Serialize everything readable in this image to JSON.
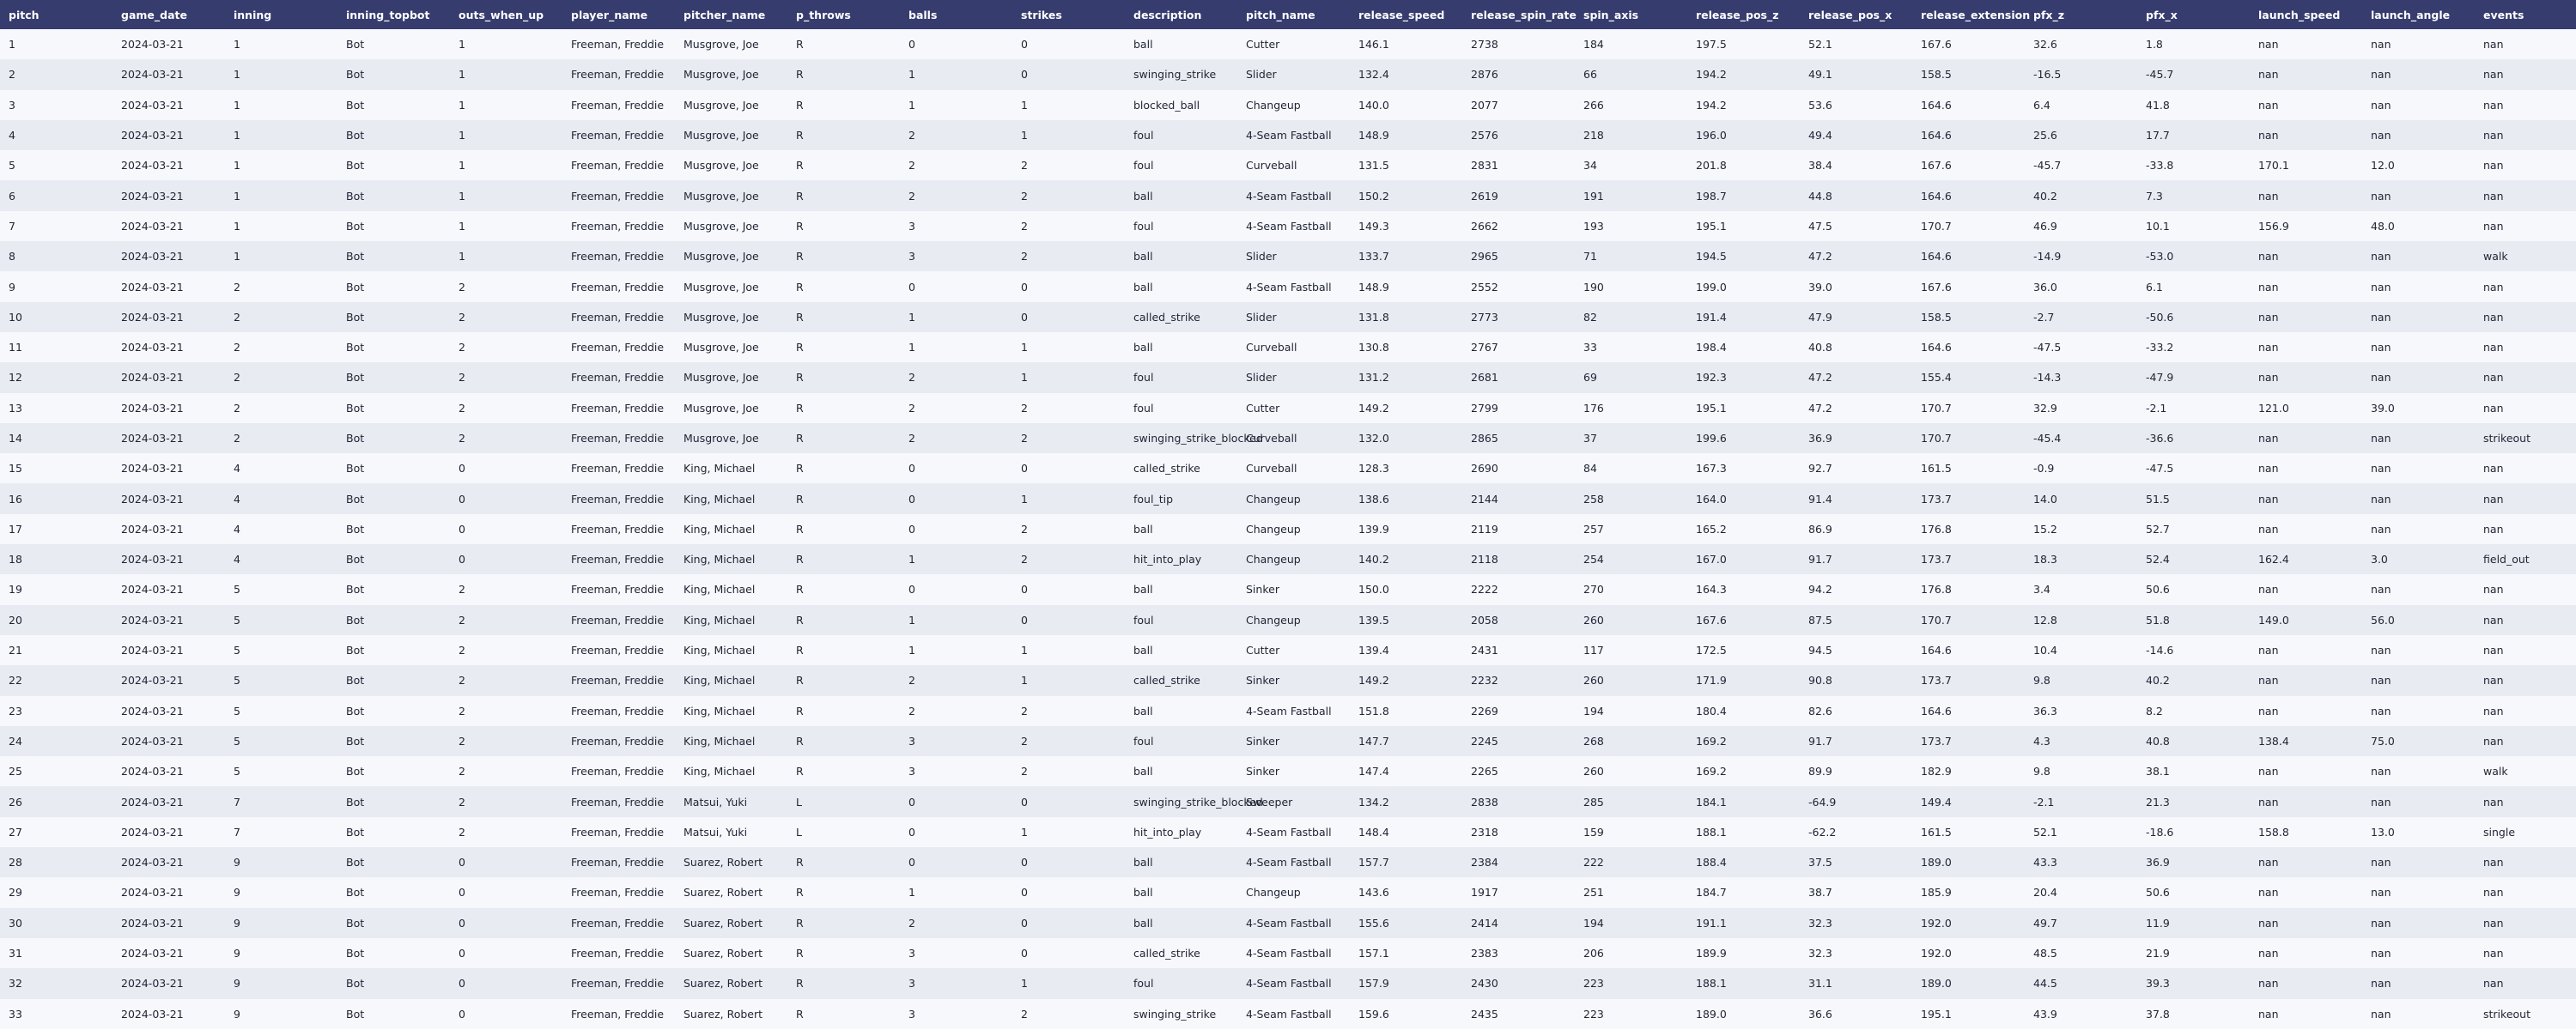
{
  "table": {
    "columns": [
      "pitch",
      "game_date",
      "inning",
      "inning_topbot",
      "outs_when_up",
      "player_name",
      "pitcher_name",
      "p_throws",
      "balls",
      "strikes",
      "description",
      "pitch_name",
      "release_speed",
      "release_spin_rate",
      "spin_axis",
      "release_pos_z",
      "release_pos_x",
      "release_extension",
      "pfx_z",
      "pfx_x",
      "launch_speed",
      "launch_angle",
      "events"
    ],
    "rows": [
      [
        "1",
        "2024-03-21",
        "1",
        "Bot",
        "1",
        "Freeman, Freddie",
        "Musgrove, Joe",
        "R",
        "0",
        "0",
        "ball",
        "Cutter",
        "146.1",
        "2738",
        "184",
        "197.5",
        "52.1",
        "167.6",
        "32.6",
        "1.8",
        "nan",
        "nan",
        "nan"
      ],
      [
        "2",
        "2024-03-21",
        "1",
        "Bot",
        "1",
        "Freeman, Freddie",
        "Musgrove, Joe",
        "R",
        "1",
        "0",
        "swinging_strike",
        "Slider",
        "132.4",
        "2876",
        "66",
        "194.2",
        "49.1",
        "158.5",
        "-16.5",
        "-45.7",
        "nan",
        "nan",
        "nan"
      ],
      [
        "3",
        "2024-03-21",
        "1",
        "Bot",
        "1",
        "Freeman, Freddie",
        "Musgrove, Joe",
        "R",
        "1",
        "1",
        "blocked_ball",
        "Changeup",
        "140.0",
        "2077",
        "266",
        "194.2",
        "53.6",
        "164.6",
        "6.4",
        "41.8",
        "nan",
        "nan",
        "nan"
      ],
      [
        "4",
        "2024-03-21",
        "1",
        "Bot",
        "1",
        "Freeman, Freddie",
        "Musgrove, Joe",
        "R",
        "2",
        "1",
        "foul",
        "4-Seam Fastball",
        "148.9",
        "2576",
        "218",
        "196.0",
        "49.4",
        "164.6",
        "25.6",
        "17.7",
        "nan",
        "nan",
        "nan"
      ],
      [
        "5",
        "2024-03-21",
        "1",
        "Bot",
        "1",
        "Freeman, Freddie",
        "Musgrove, Joe",
        "R",
        "2",
        "2",
        "foul",
        "Curveball",
        "131.5",
        "2831",
        "34",
        "201.8",
        "38.4",
        "167.6",
        "-45.7",
        "-33.8",
        "170.1",
        "12.0",
        "nan"
      ],
      [
        "6",
        "2024-03-21",
        "1",
        "Bot",
        "1",
        "Freeman, Freddie",
        "Musgrove, Joe",
        "R",
        "2",
        "2",
        "ball",
        "4-Seam Fastball",
        "150.2",
        "2619",
        "191",
        "198.7",
        "44.8",
        "164.6",
        "40.2",
        "7.3",
        "nan",
        "nan",
        "nan"
      ],
      [
        "7",
        "2024-03-21",
        "1",
        "Bot",
        "1",
        "Freeman, Freddie",
        "Musgrove, Joe",
        "R",
        "3",
        "2",
        "foul",
        "4-Seam Fastball",
        "149.3",
        "2662",
        "193",
        "195.1",
        "47.5",
        "170.7",
        "46.9",
        "10.1",
        "156.9",
        "48.0",
        "nan"
      ],
      [
        "8",
        "2024-03-21",
        "1",
        "Bot",
        "1",
        "Freeman, Freddie",
        "Musgrove, Joe",
        "R",
        "3",
        "2",
        "ball",
        "Slider",
        "133.7",
        "2965",
        "71",
        "194.5",
        "47.2",
        "164.6",
        "-14.9",
        "-53.0",
        "nan",
        "nan",
        "walk"
      ],
      [
        "9",
        "2024-03-21",
        "2",
        "Bot",
        "2",
        "Freeman, Freddie",
        "Musgrove, Joe",
        "R",
        "0",
        "0",
        "ball",
        "4-Seam Fastball",
        "148.9",
        "2552",
        "190",
        "199.0",
        "39.0",
        "167.6",
        "36.0",
        "6.1",
        "nan",
        "nan",
        "nan"
      ],
      [
        "10",
        "2024-03-21",
        "2",
        "Bot",
        "2",
        "Freeman, Freddie",
        "Musgrove, Joe",
        "R",
        "1",
        "0",
        "called_strike",
        "Slider",
        "131.8",
        "2773",
        "82",
        "191.4",
        "47.9",
        "158.5",
        "-2.7",
        "-50.6",
        "nan",
        "nan",
        "nan"
      ],
      [
        "11",
        "2024-03-21",
        "2",
        "Bot",
        "2",
        "Freeman, Freddie",
        "Musgrove, Joe",
        "R",
        "1",
        "1",
        "ball",
        "Curveball",
        "130.8",
        "2767",
        "33",
        "198.4",
        "40.8",
        "164.6",
        "-47.5",
        "-33.2",
        "nan",
        "nan",
        "nan"
      ],
      [
        "12",
        "2024-03-21",
        "2",
        "Bot",
        "2",
        "Freeman, Freddie",
        "Musgrove, Joe",
        "R",
        "2",
        "1",
        "foul",
        "Slider",
        "131.2",
        "2681",
        "69",
        "192.3",
        "47.2",
        "155.4",
        "-14.3",
        "-47.9",
        "nan",
        "nan",
        "nan"
      ],
      [
        "13",
        "2024-03-21",
        "2",
        "Bot",
        "2",
        "Freeman, Freddie",
        "Musgrove, Joe",
        "R",
        "2",
        "2",
        "foul",
        "Cutter",
        "149.2",
        "2799",
        "176",
        "195.1",
        "47.2",
        "170.7",
        "32.9",
        "-2.1",
        "121.0",
        "39.0",
        "nan"
      ],
      [
        "14",
        "2024-03-21",
        "2",
        "Bot",
        "2",
        "Freeman, Freddie",
        "Musgrove, Joe",
        "R",
        "2",
        "2",
        "swinging_strike_blocked",
        "Curveball",
        "132.0",
        "2865",
        "37",
        "199.6",
        "36.9",
        "170.7",
        "-45.4",
        "-36.6",
        "nan",
        "nan",
        "strikeout"
      ],
      [
        "15",
        "2024-03-21",
        "4",
        "Bot",
        "0",
        "Freeman, Freddie",
        "King, Michael",
        "R",
        "0",
        "0",
        "called_strike",
        "Curveball",
        "128.3",
        "2690",
        "84",
        "167.3",
        "92.7",
        "161.5",
        "-0.9",
        "-47.5",
        "nan",
        "nan",
        "nan"
      ],
      [
        "16",
        "2024-03-21",
        "4",
        "Bot",
        "0",
        "Freeman, Freddie",
        "King, Michael",
        "R",
        "0",
        "1",
        "foul_tip",
        "Changeup",
        "138.6",
        "2144",
        "258",
        "164.0",
        "91.4",
        "173.7",
        "14.0",
        "51.5",
        "nan",
        "nan",
        "nan"
      ],
      [
        "17",
        "2024-03-21",
        "4",
        "Bot",
        "0",
        "Freeman, Freddie",
        "King, Michael",
        "R",
        "0",
        "2",
        "ball",
        "Changeup",
        "139.9",
        "2119",
        "257",
        "165.2",
        "86.9",
        "176.8",
        "15.2",
        "52.7",
        "nan",
        "nan",
        "nan"
      ],
      [
        "18",
        "2024-03-21",
        "4",
        "Bot",
        "0",
        "Freeman, Freddie",
        "King, Michael",
        "R",
        "1",
        "2",
        "hit_into_play",
        "Changeup",
        "140.2",
        "2118",
        "254",
        "167.0",
        "91.7",
        "173.7",
        "18.3",
        "52.4",
        "162.4",
        "3.0",
        "field_out"
      ],
      [
        "19",
        "2024-03-21",
        "5",
        "Bot",
        "2",
        "Freeman, Freddie",
        "King, Michael",
        "R",
        "0",
        "0",
        "ball",
        "Sinker",
        "150.0",
        "2222",
        "270",
        "164.3",
        "94.2",
        "176.8",
        "3.4",
        "50.6",
        "nan",
        "nan",
        "nan"
      ],
      [
        "20",
        "2024-03-21",
        "5",
        "Bot",
        "2",
        "Freeman, Freddie",
        "King, Michael",
        "R",
        "1",
        "0",
        "foul",
        "Changeup",
        "139.5",
        "2058",
        "260",
        "167.6",
        "87.5",
        "170.7",
        "12.8",
        "51.8",
        "149.0",
        "56.0",
        "nan"
      ],
      [
        "21",
        "2024-03-21",
        "5",
        "Bot",
        "2",
        "Freeman, Freddie",
        "King, Michael",
        "R",
        "1",
        "1",
        "ball",
        "Cutter",
        "139.4",
        "2431",
        "117",
        "172.5",
        "94.5",
        "164.6",
        "10.4",
        "-14.6",
        "nan",
        "nan",
        "nan"
      ],
      [
        "22",
        "2024-03-21",
        "5",
        "Bot",
        "2",
        "Freeman, Freddie",
        "King, Michael",
        "R",
        "2",
        "1",
        "called_strike",
        "Sinker",
        "149.2",
        "2232",
        "260",
        "171.9",
        "90.8",
        "173.7",
        "9.8",
        "40.2",
        "nan",
        "nan",
        "nan"
      ],
      [
        "23",
        "2024-03-21",
        "5",
        "Bot",
        "2",
        "Freeman, Freddie",
        "King, Michael",
        "R",
        "2",
        "2",
        "ball",
        "4-Seam Fastball",
        "151.8",
        "2269",
        "194",
        "180.4",
        "82.6",
        "164.6",
        "36.3",
        "8.2",
        "nan",
        "nan",
        "nan"
      ],
      [
        "24",
        "2024-03-21",
        "5",
        "Bot",
        "2",
        "Freeman, Freddie",
        "King, Michael",
        "R",
        "3",
        "2",
        "foul",
        "Sinker",
        "147.7",
        "2245",
        "268",
        "169.2",
        "91.7",
        "173.7",
        "4.3",
        "40.8",
        "138.4",
        "75.0",
        "nan"
      ],
      [
        "25",
        "2024-03-21",
        "5",
        "Bot",
        "2",
        "Freeman, Freddie",
        "King, Michael",
        "R",
        "3",
        "2",
        "ball",
        "Sinker",
        "147.4",
        "2265",
        "260",
        "169.2",
        "89.9",
        "182.9",
        "9.8",
        "38.1",
        "nan",
        "nan",
        "walk"
      ],
      [
        "26",
        "2024-03-21",
        "7",
        "Bot",
        "2",
        "Freeman, Freddie",
        "Matsui, Yuki",
        "L",
        "0",
        "0",
        "swinging_strike_blocked",
        "Sweeper",
        "134.2",
        "2838",
        "285",
        "184.1",
        "-64.9",
        "149.4",
        "-2.1",
        "21.3",
        "nan",
        "nan",
        "nan"
      ],
      [
        "27",
        "2024-03-21",
        "7",
        "Bot",
        "2",
        "Freeman, Freddie",
        "Matsui, Yuki",
        "L",
        "0",
        "1",
        "hit_into_play",
        "4-Seam Fastball",
        "148.4",
        "2318",
        "159",
        "188.1",
        "-62.2",
        "161.5",
        "52.1",
        "-18.6",
        "158.8",
        "13.0",
        "single"
      ],
      [
        "28",
        "2024-03-21",
        "9",
        "Bot",
        "0",
        "Freeman, Freddie",
        "Suarez, Robert",
        "R",
        "0",
        "0",
        "ball",
        "4-Seam Fastball",
        "157.7",
        "2384",
        "222",
        "188.4",
        "37.5",
        "189.0",
        "43.3",
        "36.9",
        "nan",
        "nan",
        "nan"
      ],
      [
        "29",
        "2024-03-21",
        "9",
        "Bot",
        "0",
        "Freeman, Freddie",
        "Suarez, Robert",
        "R",
        "1",
        "0",
        "ball",
        "Changeup",
        "143.6",
        "1917",
        "251",
        "184.7",
        "38.7",
        "185.9",
        "20.4",
        "50.6",
        "nan",
        "nan",
        "nan"
      ],
      [
        "30",
        "2024-03-21",
        "9",
        "Bot",
        "0",
        "Freeman, Freddie",
        "Suarez, Robert",
        "R",
        "2",
        "0",
        "ball",
        "4-Seam Fastball",
        "155.6",
        "2414",
        "194",
        "191.1",
        "32.3",
        "192.0",
        "49.7",
        "11.9",
        "nan",
        "nan",
        "nan"
      ],
      [
        "31",
        "2024-03-21",
        "9",
        "Bot",
        "0",
        "Freeman, Freddie",
        "Suarez, Robert",
        "R",
        "3",
        "0",
        "called_strike",
        "4-Seam Fastball",
        "157.1",
        "2383",
        "206",
        "189.9",
        "32.3",
        "192.0",
        "48.5",
        "21.9",
        "nan",
        "nan",
        "nan"
      ],
      [
        "32",
        "2024-03-21",
        "9",
        "Bot",
        "0",
        "Freeman, Freddie",
        "Suarez, Robert",
        "R",
        "3",
        "1",
        "foul",
        "4-Seam Fastball",
        "157.9",
        "2430",
        "223",
        "188.1",
        "31.1",
        "189.0",
        "44.5",
        "39.3",
        "nan",
        "nan",
        "nan"
      ],
      [
        "33",
        "2024-03-21",
        "9",
        "Bot",
        "0",
        "Freeman, Freddie",
        "Suarez, Robert",
        "R",
        "3",
        "2",
        "swinging_strike",
        "4-Seam Fastball",
        "159.6",
        "2435",
        "223",
        "189.0",
        "36.6",
        "195.1",
        "43.9",
        "37.8",
        "nan",
        "nan",
        "strikeout"
      ]
    ]
  }
}
